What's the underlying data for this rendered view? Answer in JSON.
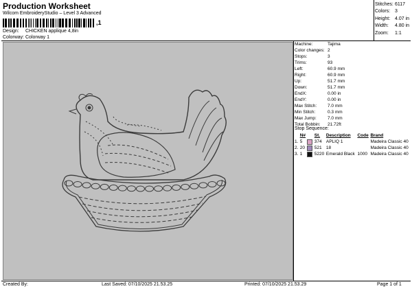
{
  "header": {
    "title": "Production Worksheet",
    "subtitle": "Wilcom EmbroideryStudio – Level 3 Advanced",
    "barcode_text": ",1"
  },
  "design": {
    "design_label": "Design:",
    "design_value": "CHICKEN applique 4,8in",
    "colorway_label": "Colorway:",
    "colorway_value": "Colorway 1"
  },
  "stats": [
    {
      "label": "Stitches:",
      "value": "6117"
    },
    {
      "label": "Colors:",
      "value": "3"
    },
    {
      "label": "Height:",
      "value": "4.07 in"
    },
    {
      "label": "Width:",
      "value": "4.80 in"
    },
    {
      "label": "Zoom:",
      "value": "1:1"
    }
  ],
  "info": [
    {
      "label": "Machine:",
      "value": "Tajima"
    },
    {
      "label": "Color changes:",
      "value": "2"
    },
    {
      "label": "Stops:",
      "value": "3"
    },
    {
      "label": "Trims:",
      "value": "93"
    },
    {
      "label": "Left:",
      "value": "60.9 mm"
    },
    {
      "label": "Right:",
      "value": "60.9 mm"
    },
    {
      "label": "Up:",
      "value": "51.7 mm"
    },
    {
      "label": "Down:",
      "value": "51.7 mm"
    },
    {
      "label": "EndX:",
      "value": "0.00 in"
    },
    {
      "label": "EndY:",
      "value": "0.00 in"
    },
    {
      "label": "Max Stitch:",
      "value": "7.0 mm"
    },
    {
      "label": "Min Stitch:",
      "value": "0.3 mm"
    },
    {
      "label": "Max Jump:",
      "value": "7.0 mm"
    },
    {
      "label": "Total Bobbin:",
      "value": "21.72ft"
    }
  ],
  "stop_sequence": {
    "title": "Stop Sequence:",
    "headers": {
      "n": "N#",
      "st": "St.",
      "description": "Description",
      "code": "Code",
      "brand": "Brand"
    },
    "rows": [
      {
        "idx": "1.",
        "n": "5",
        "color": "#d9a3c3",
        "st": "374",
        "description": "APLIQ 1",
        "code": "",
        "brand": "Madeira Classic 40"
      },
      {
        "idx": "2.",
        "n": "20",
        "color": "#9e88b8",
        "st": "521",
        "description": "18",
        "code": "",
        "brand": "Madeira Classic 40"
      },
      {
        "idx": "3.",
        "n": "1",
        "color": "#111111",
        "st": "5220",
        "description": "Emerald Black",
        "code": "1000",
        "brand": "Madeira Classic 40"
      }
    ]
  },
  "footer": {
    "created_by": "Created By:",
    "last_saved": "Last Saved: 07/10/2025 21.53.25",
    "printed": "Printed: 07/10/2025 21.53.29",
    "page": "Page 1 of 1"
  },
  "colors": {
    "preview_bg": "#c0c0c0",
    "drawing_line": "#3a3a3a"
  }
}
